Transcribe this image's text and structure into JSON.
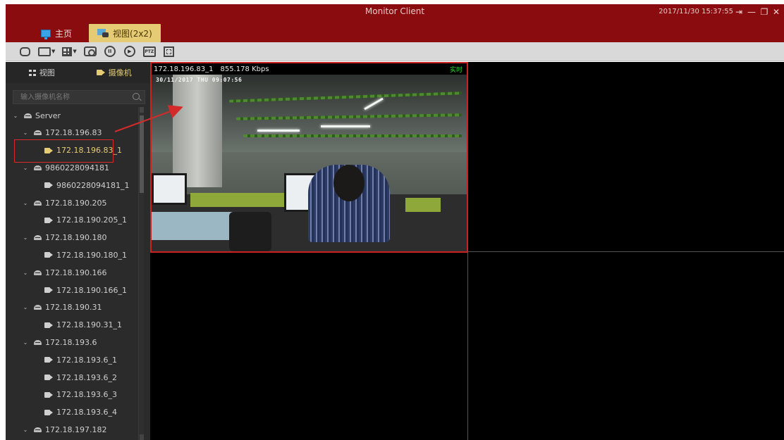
{
  "window": {
    "title": "Monitor Client",
    "datetime": "2017/11/30 15:37:55",
    "controls": {
      "logout": "⇥",
      "minimize": "—",
      "restore": "❐",
      "close": "✕"
    }
  },
  "tabs": [
    {
      "label": "主页",
      "icon": "monitor-icon"
    },
    {
      "label": "视图(2x2)",
      "icon": "view-icon",
      "active": true
    }
  ],
  "toolbar": {
    "buttons": [
      "open-view",
      "layout-select",
      "grid-layout-select",
      "snapshot",
      "pause",
      "play",
      "ptz",
      "fullscreen"
    ],
    "ptz_label": "PTZ",
    "pause_label": "II",
    "play_label": "▶"
  },
  "sidebar": {
    "tab_view": "视图",
    "tab_cameras": "摄像机",
    "search_placeholder": "输入摄像机名称",
    "tree": [
      {
        "type": "server",
        "label": "Server"
      },
      {
        "type": "device",
        "label": "172.18.196.83"
      },
      {
        "type": "camera",
        "label": "172.18.196.83_1",
        "selected": true
      },
      {
        "type": "device",
        "label": "9860228094181"
      },
      {
        "type": "camera",
        "label": "9860228094181_1"
      },
      {
        "type": "device",
        "label": "172.18.190.205"
      },
      {
        "type": "camera",
        "label": "172.18.190.205_1"
      },
      {
        "type": "device",
        "label": "172.18.190.180"
      },
      {
        "type": "camera",
        "label": "172.18.190.180_1"
      },
      {
        "type": "device",
        "label": "172.18.190.166"
      },
      {
        "type": "camera",
        "label": "172.18.190.166_1"
      },
      {
        "type": "device",
        "label": "172.18.190.31"
      },
      {
        "type": "camera",
        "label": "172.18.190.31_1"
      },
      {
        "type": "device",
        "label": "172.18.193.6"
      },
      {
        "type": "camera",
        "label": "172.18.193.6_1"
      },
      {
        "type": "camera",
        "label": "172.18.193.6_2"
      },
      {
        "type": "camera",
        "label": "172.18.193.6_3"
      },
      {
        "type": "camera",
        "label": "172.18.193.6_4"
      },
      {
        "type": "device",
        "label": "172.18.197.182"
      }
    ]
  },
  "video": {
    "pane1": {
      "camera": "172.18.196.83_1",
      "bitrate": "855.178 Kbps",
      "status": "实时",
      "osd": "30/11/2017  THU  09:07:56"
    }
  },
  "colors": {
    "titlebar": "#8a0c0f",
    "accent": "#e5cc74",
    "selection": "#d42a2a",
    "live": "#2fdc2f"
  }
}
